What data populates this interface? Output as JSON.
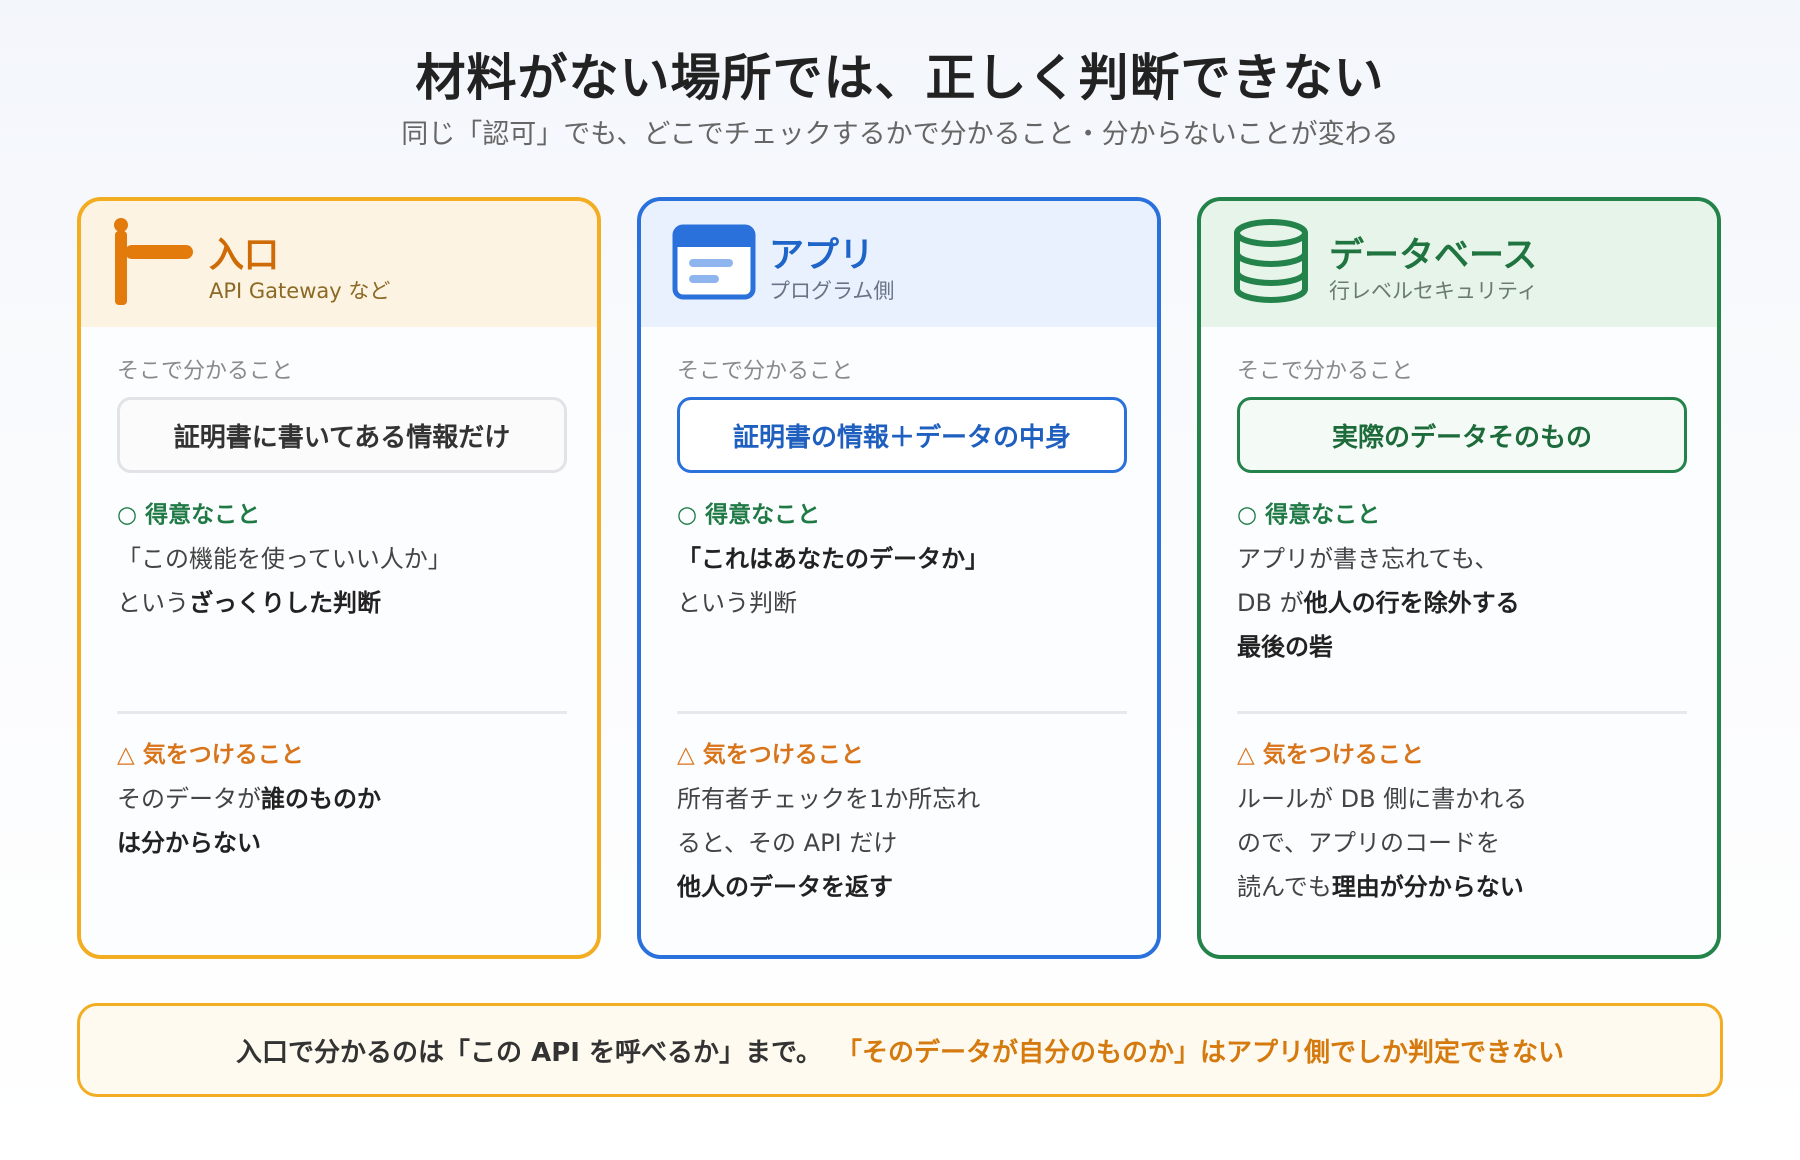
{
  "title": "材料がない場所では、正しく判断できない",
  "subtitle": "同じ「認可」でも、どこでチェックするかで分かること・分からないことが変わる",
  "cards": [
    {
      "icon": "gate-icon",
      "title": "入口",
      "subtitle": "API Gateway など",
      "knows_label": "そこで分かること",
      "knows": "証明書に書いてある情報だけ",
      "good_label": "○ 得意なこと",
      "good_lines": [
        {
          "plain": "「この機能を使っていい人か」",
          "bold": ""
        },
        {
          "plain": "という",
          "bold": "ざっくりした判断"
        }
      ],
      "warn_label": "△ 気をつけること",
      "warn_lines": [
        {
          "plain": "そのデータが",
          "bold": "誰のものか"
        },
        {
          "plain": "",
          "bold": "は分からない"
        }
      ]
    },
    {
      "icon": "app-window-icon",
      "title": "アプリ",
      "subtitle": "プログラム側",
      "knows_label": "そこで分かること",
      "knows": "証明書の情報＋データの中身",
      "good_label": "○ 得意なこと",
      "good_lines": [
        {
          "plain": "",
          "bold": "「これはあなたのデータか」"
        },
        {
          "plain": "という判断",
          "bold": ""
        }
      ],
      "warn_label": "△ 気をつけること",
      "warn_lines": [
        {
          "plain": "所有者チェックを1か所忘れ",
          "bold": ""
        },
        {
          "plain": "ると、その API だけ",
          "bold": ""
        },
        {
          "plain": "",
          "bold": "他人のデータを返す"
        }
      ]
    },
    {
      "icon": "database-icon",
      "title": "データベース",
      "subtitle": "行レベルセキュリティ",
      "knows_label": "そこで分かること",
      "knows": "実際のデータそのもの",
      "good_label": "○ 得意なこと",
      "good_lines": [
        {
          "plain": "アプリが書き忘れても、",
          "bold": ""
        },
        {
          "plain": "DB が",
          "bold": "他人の行を除外する"
        },
        {
          "plain": "",
          "bold": "最後の砦"
        }
      ],
      "warn_label": "△ 気をつけること",
      "warn_lines": [
        {
          "plain": "ルールが DB 側に書かれる",
          "bold": ""
        },
        {
          "plain": "ので、アプリのコードを",
          "bold": ""
        },
        {
          "plain": "読んでも",
          "bold": "理由が分からない"
        }
      ]
    }
  ],
  "footer": {
    "plain": "入口で分かるのは「この API を呼べるか」まで。",
    "accent": "「そのデータが自分のものか」はアプリ側でしか判定できない"
  },
  "colors": {
    "gate": "#f2ad22",
    "app": "#2a71dc",
    "db": "#24834a",
    "good": "#1f7a45",
    "warn": "#d8741a"
  }
}
